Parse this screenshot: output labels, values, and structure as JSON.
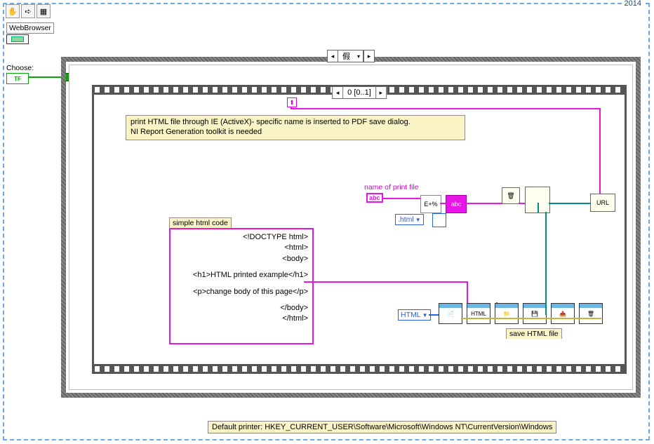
{
  "year": "2014",
  "toolbar": {
    "t1": "✋",
    "t2": "➪",
    "t3": "▦"
  },
  "terminals": {
    "web_label": "WebBrowser",
    "choose_label": "Choose:",
    "choose_val": "TF"
  },
  "case": {
    "selector_left": "◂",
    "selector_value": "假",
    "selector_dd": "▾",
    "selector_right": "▸"
  },
  "loop": {
    "selector_left": "◂",
    "selector_value": "0 [0..1]",
    "selector_right": "▸",
    "shift": "⬆"
  },
  "comment1": {
    "line1": "print HTML file through IE  (ActiveX)- specific name is inserted to PDF save dialog.",
    "line2": "NI Report Generation toolkit is needed"
  },
  "htmlbox": {
    "label": "simple html code",
    "l1": "<!DOCTYPE html>",
    "l2": "<html>",
    "l3": "<body>",
    "l4": "<h1>HTML printed example</h1>",
    "l5": "<p>change body of this page</p>",
    "l6": "</body>",
    "l7": "</html>"
  },
  "printfile": {
    "label": "name of print file",
    "abc": "abc"
  },
  "consts": {
    "ext": ".html",
    "html": "HTML"
  },
  "save_lbl": "save HTML file",
  "fn_text": {
    "ex": "E+%",
    "abc2": "abc",
    "url": "URL",
    "trash": "🗑"
  },
  "footer": "Default printer:   HKEY_CURRENT_USER\\Software\\Microsoft\\Windows NT\\CurrentVersion\\Windows"
}
